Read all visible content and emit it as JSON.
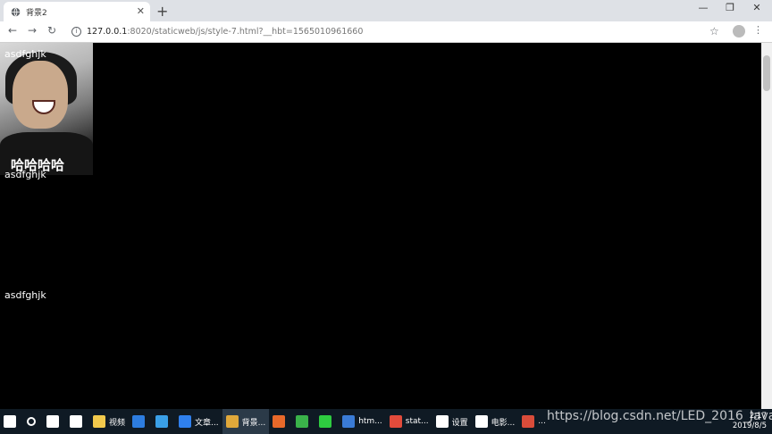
{
  "browser": {
    "tab_title": "背景2",
    "tab_close": "✕",
    "new_tab": "+",
    "url_host": "127.0.0.1",
    "url_path": ":8020/staticweb/js/style-7.html?__hbt=1565010961660",
    "window_controls": [
      "—",
      "❐",
      "✕"
    ]
  },
  "content": {
    "lines": [
      "asdfghjk",
      "asdfghjk",
      "asdfghjk"
    ],
    "image_caption": "哈哈哈哈"
  },
  "taskbar": {
    "items": [
      {
        "label": "",
        "icon": "windows-start-icon",
        "color": "#ffffff"
      },
      {
        "label": "",
        "icon": "search-icon",
        "color": "#ffffff"
      },
      {
        "label": "",
        "icon": "task-view-icon",
        "color": "#ffffff"
      },
      {
        "label": "",
        "icon": "mail-icon",
        "color": "#ffffff"
      },
      {
        "label": "视频",
        "icon": "folder-icon",
        "color": "#f2c94c"
      },
      {
        "label": "",
        "icon": "edge-icon",
        "color": "#2d7de0"
      },
      {
        "label": "",
        "icon": "ie-icon",
        "color": "#3aa0e8"
      },
      {
        "label": "文章...",
        "icon": "qq-browser-icon",
        "color": "#2f80ed"
      },
      {
        "label": "背景...",
        "icon": "chrome-icon",
        "color": "#e0a83a"
      },
      {
        "label": "",
        "icon": "firefox-icon",
        "color": "#e8692a"
      },
      {
        "label": "",
        "icon": "play-icon",
        "color": "#3ab34a"
      },
      {
        "label": "",
        "icon": "iqiyi-icon",
        "color": "#2ecc40"
      },
      {
        "label": "htm...",
        "icon": "vscode-icon",
        "color": "#3a7bd5"
      },
      {
        "label": "stat...",
        "icon": "hbuilder-icon",
        "color": "#e24b3b"
      },
      {
        "label": "设置",
        "icon": "gear-icon",
        "color": "#ffffff"
      },
      {
        "label": "电影...",
        "icon": "movie-icon",
        "color": "#ffffff"
      },
      {
        "label": "...",
        "icon": "app-icon",
        "color": "#d94c3a"
      }
    ],
    "tray_time": "2:17",
    "tray_date": "2019/8/5"
  },
  "watermark": "https://blog.csdn.net/LED_2016_Java"
}
